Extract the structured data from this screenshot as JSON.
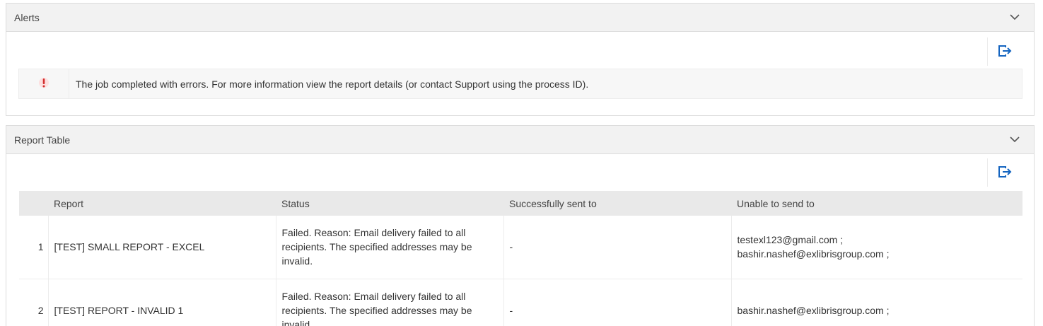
{
  "alerts_panel": {
    "title": "Alerts",
    "message": "The job completed with errors. For more information view the report details (or contact Support using the process ID)."
  },
  "report_panel": {
    "title": "Report Table",
    "columns": [
      "",
      "Report",
      "Status",
      "Successfully sent to",
      "Unable to send to"
    ],
    "rows": [
      {
        "num": "1",
        "report": "[TEST] SMALL REPORT - EXCEL",
        "status": "Failed. Reason: Email delivery failed to all recipients. The specified addresses may be invalid.",
        "sent": "-",
        "unable": "testexl123@gmail.com ; bashir.nashef@exlibrisgroup.com ;"
      },
      {
        "num": "2",
        "report": "[TEST] REPORT - INVALID 1",
        "status": "Failed. Reason: Email delivery failed to all recipients. The specified addresses may be invalid.",
        "sent": "-",
        "unable": "bashir.nashef@exlibrisgroup.com ;"
      }
    ]
  },
  "colors": {
    "header_bg": "#f2f2f2",
    "accent": "#1565c0",
    "error": "#d32f2f"
  },
  "icons": {
    "collapse": "chevron-down-icon",
    "export": "export-icon",
    "error": "error-icon"
  }
}
